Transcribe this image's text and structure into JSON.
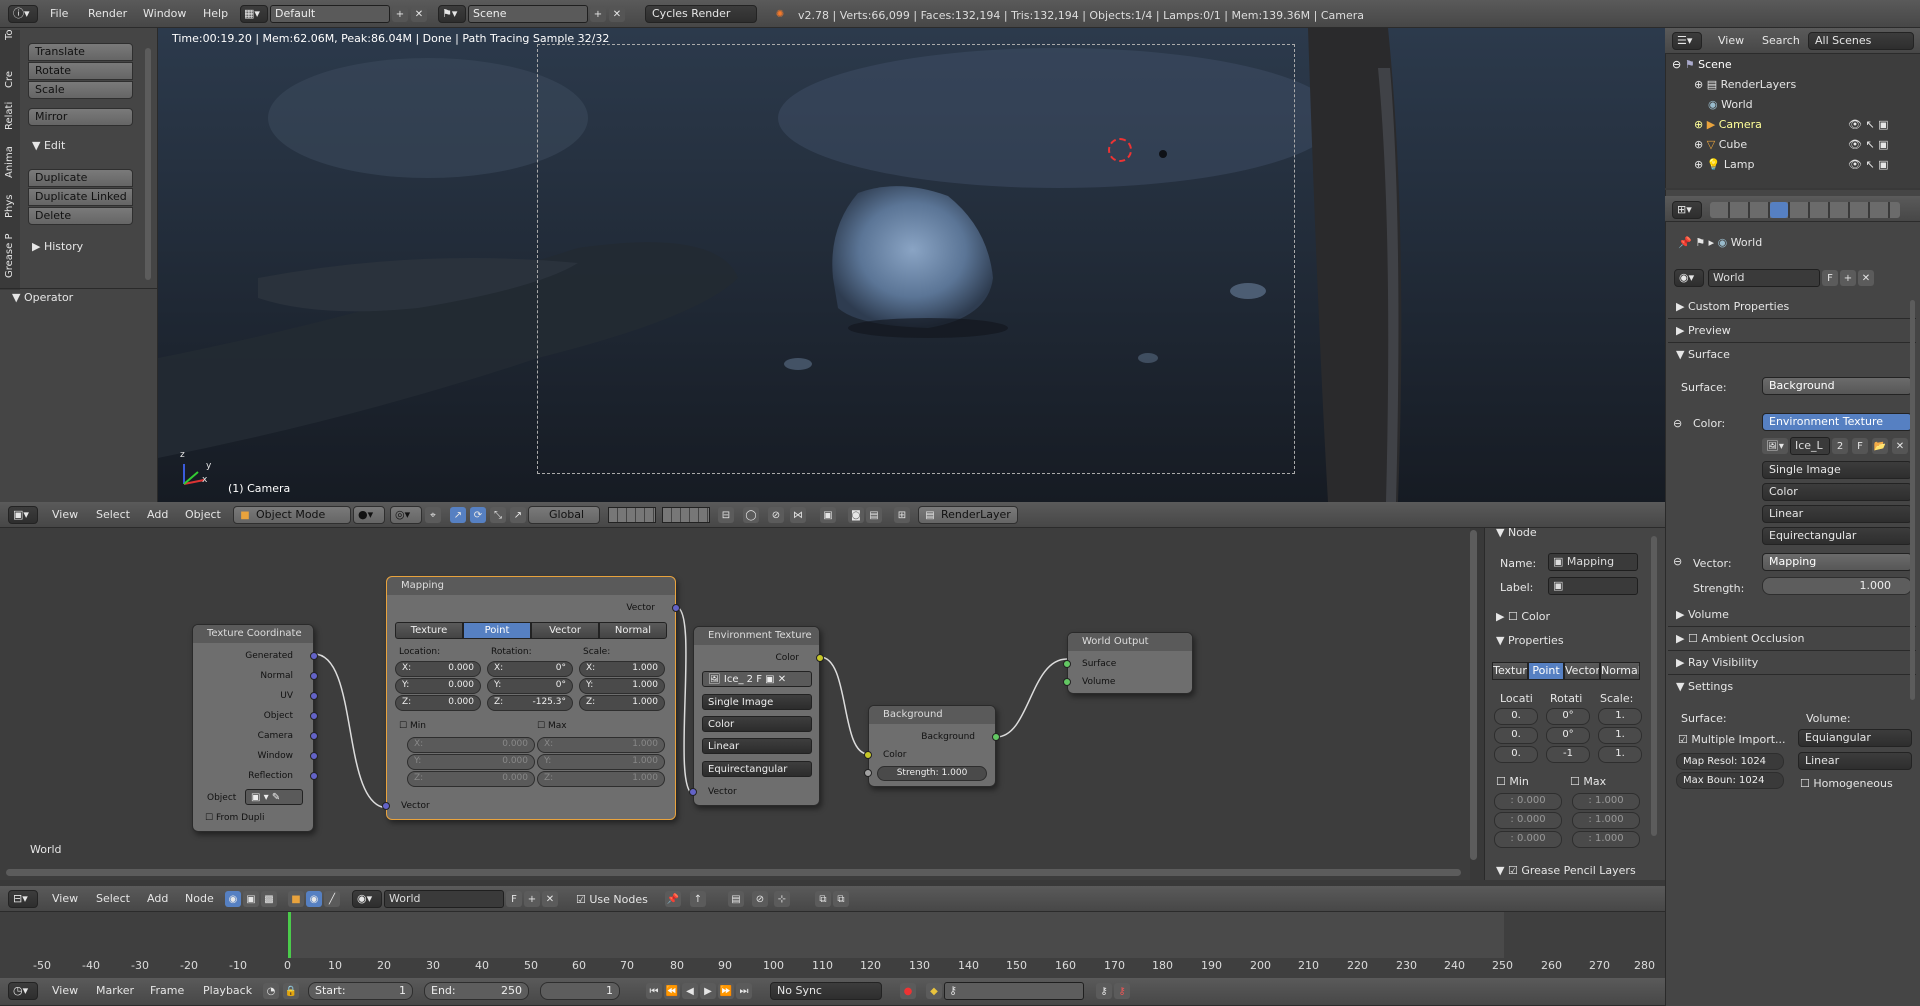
{
  "info_header": {
    "menus": [
      "File",
      "Render",
      "Window",
      "Help"
    ],
    "screen_layout": "Default",
    "scene": "Scene",
    "engine": "Cycles Render",
    "stats": "v2.78 | Verts:66,099 | Faces:132,194 | Tris:132,194 | Objects:1/4 | Lamps:0/1 | Mem:139.36M | Camera"
  },
  "tool_shelf": {
    "tabs": [
      "To",
      "Cre",
      "Relati",
      "Anima",
      "Phys",
      "Grease P"
    ],
    "transform_buttons": [
      "Translate",
      "Rotate",
      "Scale"
    ],
    "mirror": "Mirror",
    "edit_header": "Edit",
    "edit_buttons": [
      "Duplicate",
      "Duplicate Linked",
      "Delete"
    ],
    "history": "History",
    "operator": "Operator"
  },
  "viewport": {
    "render_status": "Time:00:19.20 | Mem:62.06M, Peak:86.04M | Done | Path Tracing Sample 32/32",
    "camera_label": "(1) Camera",
    "axis_labels": [
      "y",
      "x",
      "z"
    ]
  },
  "view3d_header": {
    "menus": [
      "View",
      "Select",
      "Add",
      "Object"
    ],
    "mode": "Object Mode",
    "orientation": "Global",
    "render_layer": "RenderLayer"
  },
  "outliner": {
    "menus": [
      "View",
      "Search"
    ],
    "filter": "All Scenes",
    "items": [
      {
        "label": "Scene"
      },
      {
        "label": "RenderLayers"
      },
      {
        "label": "World"
      },
      {
        "label": "Camera"
      },
      {
        "label": "Cube"
      },
      {
        "label": "Lamp"
      }
    ]
  },
  "properties": {
    "breadcrumb": "World",
    "world_name": "World",
    "fake_user": "F",
    "panels": {
      "custom_properties": "Custom Properties",
      "preview": "Preview",
      "surface": "Surface",
      "volume": "Volume",
      "ambient_occlusion": "Ambient Occlusion",
      "ray_visibility": "Ray Visibility",
      "settings": "Settings"
    },
    "surface_label": "Surface:",
    "surface_value": "Background",
    "color_label": "Color:",
    "color_value": "Environment Texture",
    "image_name": "Ice_L",
    "image_users": "2",
    "image_fake": "F",
    "source": "Single Image",
    "color_space": "Color",
    "interpolation": "Linear",
    "projection": "Equirectangular",
    "vector_label": "Vector:",
    "vector_value": "Mapping",
    "strength_label": "Strength:",
    "strength_value": "1.000",
    "settings": {
      "surface_label": "Surface:",
      "volume_label": "Volume:",
      "multiple_importance": "Multiple Import...",
      "map_resolution": "Map Resol: 1024",
      "max_bounces": "Max Boun: 1024",
      "volume_sampling": "Equiangular",
      "volume_interp": "Linear",
      "homogeneous": "Homogeneous"
    }
  },
  "node_editor": {
    "world_label": "World",
    "header": {
      "menus": [
        "View",
        "Select",
        "Add",
        "Node"
      ],
      "world": "World",
      "fake": "F",
      "use_nodes": "Use Nodes"
    },
    "texcoord": {
      "title": "Texture Coordinate",
      "outputs": [
        "Generated",
        "Normal",
        "UV",
        "Object",
        "Camera",
        "Window",
        "Reflection"
      ],
      "object_label": "Object",
      "from_dupli": "From Dupli"
    },
    "mapping": {
      "title": "Mapping",
      "vector_out": "Vector",
      "tabs": [
        "Texture",
        "Point",
        "Vector",
        "Normal"
      ],
      "active_tab": "Point",
      "location_label": "Location:",
      "rotation_label": "Rotation:",
      "scale_label": "Scale:",
      "location": [
        "X:",
        "0.000",
        "Y:",
        "0.000",
        "Z:",
        "0.000"
      ],
      "rotation": [
        "X:",
        "0°",
        "Y:",
        "0°",
        "Z:",
        "-125.3°"
      ],
      "scale": [
        "X:",
        "1.000",
        "Y:",
        "1.000",
        "Z:",
        "1.000"
      ],
      "min_label": "Min",
      "max_label": "Max",
      "min": [
        "X:",
        "0.000",
        "Y:",
        "0.000",
        "Z:",
        "0.000"
      ],
      "max": [
        "X:",
        "1.000",
        "Y:",
        "1.000",
        "Z:",
        "1.000"
      ],
      "vector_in": "Vector"
    },
    "envtex": {
      "title": "Environment Texture",
      "color_out": "Color",
      "image": "Ice_",
      "users": "2",
      "fake": "F",
      "source": "Single Image",
      "color_space": "Color",
      "interp": "Linear",
      "projection": "Equirectangular",
      "vector_in": "Vector"
    },
    "background": {
      "title": "Background",
      "out": "Background",
      "color_in": "Color",
      "strength": "Strength:  1.000"
    },
    "world_output": {
      "title": "World Output",
      "surface": "Surface",
      "volume": "Volume"
    },
    "sidebar": {
      "node_header": "Node",
      "name_label": "Name:",
      "name_value": "Mapping",
      "label_label": "Label:",
      "color_header": "Color",
      "properties_header": "Properties",
      "tabs": [
        "Textur",
        "Point",
        "Vector",
        "Normal"
      ],
      "loc_label": "Locati",
      "rot_label": "Rotati",
      "scale_label": "Scale:",
      "loc": [
        "0.",
        "0.",
        "0."
      ],
      "rot": [
        "0°",
        "0°",
        "-1"
      ],
      "scale": [
        "1.",
        "1.",
        "1."
      ],
      "min_label": "Min",
      "max_label": "Max",
      "min": [
        ": 0.000",
        ": 0.000",
        ": 0.000"
      ],
      "max": [
        ": 1.000",
        ": 1.000",
        ": 1.000"
      ],
      "grease_pencil": "Grease Pencil Layers"
    }
  },
  "timeline": {
    "ticks": [
      "-50",
      "-40",
      "-30",
      "-20",
      "-10",
      "0",
      "10",
      "20",
      "30",
      "40",
      "50",
      "60",
      "70",
      "80",
      "90",
      "100",
      "110",
      "120",
      "130",
      "140",
      "150",
      "160",
      "170",
      "180",
      "190",
      "200",
      "210",
      "220",
      "230",
      "240",
      "250",
      "260",
      "270",
      "280"
    ],
    "menus": [
      "View",
      "Marker",
      "Frame",
      "Playback"
    ],
    "start": "Start:",
    "start_value": "1",
    "end": "End:",
    "end_value": "250",
    "current_frame": "1",
    "sync": "No Sync"
  },
  "colors": {
    "accent_blue": "#5680c2",
    "header_bg": "#4a4a4a",
    "panel_bg": "#393939",
    "node_selected_border": "#e9a33d",
    "socket_vector": "#6363c7",
    "socket_color": "#c7c729",
    "socket_shader": "#63c763",
    "socket_value": "#a1a1a1"
  }
}
